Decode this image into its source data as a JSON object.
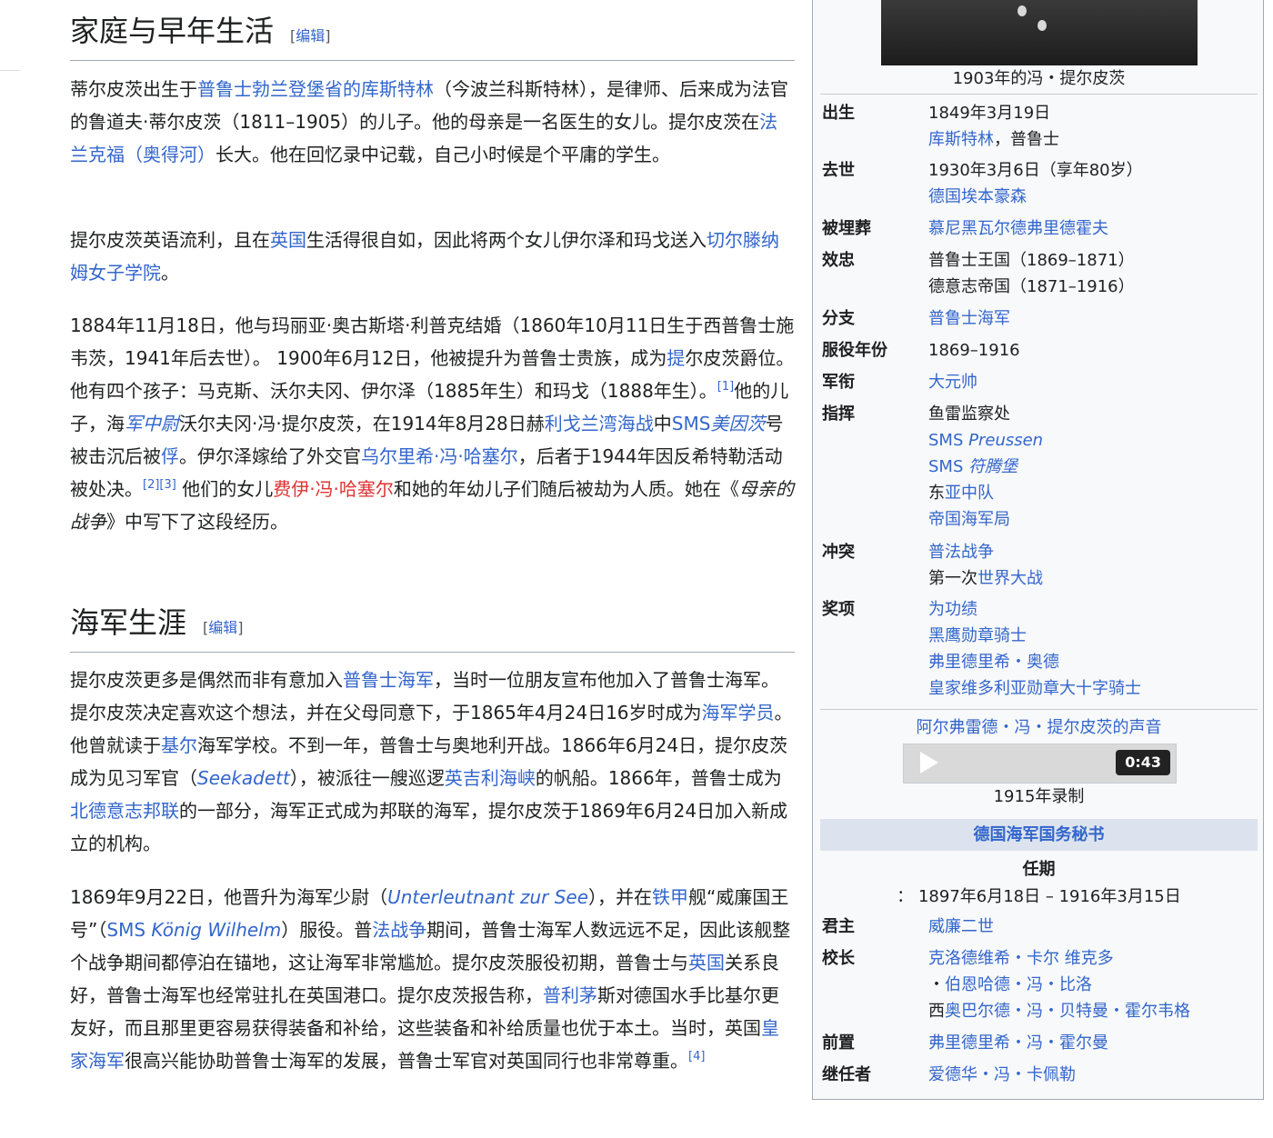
{
  "sections": {
    "family": {
      "title": "家庭与早年生活",
      "edit_open": "[",
      "edit_label": "编辑",
      "edit_close": "]"
    },
    "navy": {
      "title": "海军生涯",
      "edit_open": "[",
      "edit_label": "编辑",
      "edit_close": "]"
    }
  },
  "p1": {
    "t1": "蒂尔皮茨出生于",
    "l1": "普鲁士勃兰登堡省的库斯特林",
    "t2": "（今波兰科斯特林），是律师、后来成为法官的鲁道夫·蒂尔皮茨（1811–1905）的儿子。他的母亲是一名医生的女儿。提尔皮茨在",
    "l2": "法兰克福（奥得河）",
    "t3": "长大。他在回忆录中记载，自己小时候是个平庸的学生。"
  },
  "p2": {
    "t1": "提尔皮茨英语流利，且在",
    "l1": "英国",
    "t2": "生活得很自如，因此将两个女儿伊尔泽和玛戈送入",
    "l2": "切尔滕纳姆女子学院",
    "t3": "。"
  },
  "p3": {
    "t1": "1884年11月18日，他与玛丽亚·奥古斯塔·利普克结婚（1860年10月11日生于西普鲁士施韦茨，1941年后去世）。 1900年6月12日，他被提升为普鲁士贵族，成为",
    "l1": "提",
    "t2": "尔皮茨爵位。他有四个孩子：马克斯、沃尔夫冈、伊尔泽（1885年生）和玛戈（1888年生）。",
    "ref1": "[1]",
    "t3": "他的儿子，海",
    "l2": "军中尉",
    "t4": "沃尔夫冈·冯·提尔皮茨，在1914年8月28日赫",
    "l3": "利戈兰湾海战",
    "t5": "中",
    "l4a": "SMS",
    "l4b": "美因茨",
    "t6": "号被击沉后被",
    "l5": "俘",
    "t7": "。伊尔泽嫁给了外交官",
    "l6": "乌尔里希·冯·哈塞尔",
    "t8": "，后者于1944年因反希特勒活动被处决。",
    "ref2": "[2]",
    "ref3": "[3]",
    "t9": " 他们的女儿",
    "r1": "费伊·冯·哈塞尔",
    "t10": "和她的年幼儿子们随后被劫为人质。她在《",
    "i1": "母亲的战争",
    "t11": "》中写下了这段经历。"
  },
  "p4": {
    "t1": "提尔皮茨更多是偶然而非有意加入",
    "l1": "普鲁士海军",
    "t2": "，当时一位朋友宣布他加入了普鲁士海军。提尔皮茨决定喜欢这个想法，并在父母同意下，于1865年4月24日16岁时成为",
    "l2": "海军学员",
    "t3": "。他曾就读于",
    "l3": "基尔",
    "t4": "海军学校。不到一年，普鲁士与奥地利开战。1866年6月24日，提尔皮茨成为见习军官（",
    "l4": "Seekadett",
    "t5": "），被派往一艘巡逻",
    "l5": "英吉利海峡",
    "t6": "的帆船。1866年，普鲁士成为",
    "l6": "北德意志邦联",
    "t7": "的一部分，海军正式成为邦联的海军，提尔皮茨于1869年6月24日加入新成立的机构。"
  },
  "p5": {
    "t1": "1869年9月22日，他晋升为海军少尉（",
    "l1": "Unterleutnant zur See",
    "t2": "），并在",
    "l2": "铁甲",
    "t3": "舰“威廉国王号”（",
    "l3a": "SMS ",
    "l3b": "König Wilhelm",
    "t4": "）服役。普",
    "l4": "法战争",
    "t5": "期间，普鲁士海军人数远远不足，因此该舰整个战争期间都停泊在锚地，这让海军非常尴尬。提尔皮茨服役初期，普鲁士与",
    "l5": "英国",
    "t6": "关系良好，普鲁士海军也经常驻扎在英国港口。提尔皮茨报告称，",
    "l6": "普利茅",
    "t7": "斯对德国水手比基尔更友好，而且那里更容易获得装备和补给，这些装备和补给质量也优于本土。当时，英国",
    "l7": "皇家海军",
    "t8": "很高兴能协助普鲁士海军的发展，普鲁士军官对英国同行也非常尊重。",
    "ref4": "[4]"
  },
  "infobox": {
    "photo_caption": "1903年的冯・提尔皮茨",
    "born": {
      "label": "出生",
      "date": "1849年3月19日",
      "place_link": "库斯特林",
      "place_rest": "，普鲁士"
    },
    "died": {
      "label": "去世",
      "date": "1930年3月6日（享年80岁）",
      "place_link": "德国埃本豪森"
    },
    "buried": {
      "label": "被埋葬",
      "value": "慕尼黑瓦尔德弗里德霍夫"
    },
    "allegiance": {
      "label": "效忠",
      "v1": "普鲁士王国（1869–1871）",
      "v2": "德意志帝国（1871–1916）"
    },
    "branch": {
      "label": "分支",
      "value": "普鲁士海军"
    },
    "years": {
      "label": "服役年份",
      "value": "1869–1916"
    },
    "rank": {
      "label": "军衔",
      "value": "大元帅"
    },
    "commands": {
      "label": "指挥",
      "c1": "鱼雷监察处",
      "c2a": "SMS ",
      "c2b": "Preussen",
      "c3a": "SMS ",
      "c3b": "符腾堡",
      "c4a": "东",
      "c4b": "亚中队",
      "c5": "帝国海军局"
    },
    "battles": {
      "label": "冲突",
      "b1": "普法战争",
      "b2a": "第一次",
      "b2b": "世界大战"
    },
    "awards": {
      "label": "奖项",
      "a1": "为功绩",
      "a2": "黑鹰勋章骑士",
      "a3": "弗里德里希・奥德",
      "a4": "皇家维多利亚勋章大十字骑士"
    },
    "audio": {
      "title": "阿尔弗雷德・冯・提尔皮茨的声音",
      "time": "0:43",
      "caption": "1915年录制"
    },
    "office": {
      "header": "德国海军国务秘书",
      "term_label": "任期",
      "term_value": "： 1897年6月18日 – 1916年3月15日",
      "monarch_label": "君主",
      "monarch": "威廉二世",
      "chancellor_label": "校长",
      "ch1": "克洛德维希・卡尔 维克多",
      "ch2a": "・",
      "ch2b": "伯恩哈德・冯・比洛",
      "ch3a": "西",
      "ch3b": "奥巴尔德・冯・贝特曼・霍尔韦格",
      "preceded_label": "前置",
      "preceded": "弗里德里希・冯・霍尔曼",
      "succeeded_label": "继任者",
      "succeeded": "爱德华・冯・卡佩勒"
    }
  }
}
